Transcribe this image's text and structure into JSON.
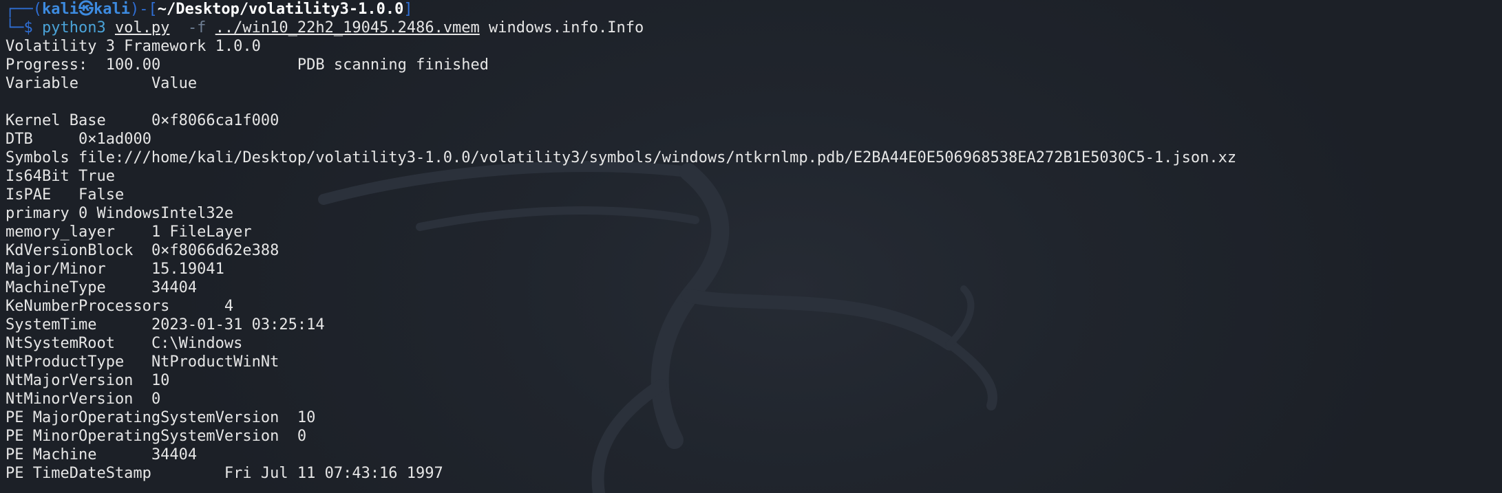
{
  "prompt": {
    "box_top_prefix": "┌──(",
    "user": "kali",
    "at_symbol": "㉿",
    "host": "kali",
    "bracket_mid": ")-[",
    "cwd": "~/Desktop/volatility3-1.0.0",
    "bracket_end": "]",
    "box_bottom_prefix": "└─$ ",
    "command": "python3",
    "script": "vol.py",
    "flag": "-f",
    "image_path": "../win10_22h2_19045.2486.vmem",
    "plugin": "windows.info.Info"
  },
  "output": {
    "framework": "Volatility 3 Framework 1.0.0",
    "progress_label": "Progress:",
    "progress_value": "100.00",
    "progress_status": "PDB scanning finished",
    "header_variable": "Variable",
    "header_value": "Value",
    "rows": [
      {
        "key": "Kernel Base",
        "value": "0×f8066ca1f000"
      },
      {
        "key": "DTB",
        "value": "0×1ad000"
      },
      {
        "key": "Symbols",
        "value": "file:///home/kali/Desktop/volatility3-1.0.0/volatility3/symbols/windows/ntkrnlmp.pdb/E2BA44E0E506968538EA272B1E5030C5-1.json.xz"
      },
      {
        "key": "Is64Bit",
        "value": "True"
      },
      {
        "key": "IsPAE",
        "value": "False"
      },
      {
        "key": "primary",
        "value": "0 WindowsIntel32e"
      },
      {
        "key": "memory_layer",
        "value": "1 FileLayer"
      },
      {
        "key": "KdVersionBlock",
        "value": "0×f8066d62e388"
      },
      {
        "key": "Major/Minor",
        "value": "15.19041"
      },
      {
        "key": "MachineType",
        "value": "34404"
      },
      {
        "key": "KeNumberProcessors",
        "value": "4"
      },
      {
        "key": "SystemTime",
        "value": "2023-01-31 03:25:14"
      },
      {
        "key": "NtSystemRoot",
        "value": "C:\\Windows"
      },
      {
        "key": "NtProductType",
        "value": "NtProductWinNt"
      },
      {
        "key": "NtMajorVersion",
        "value": "10"
      },
      {
        "key": "NtMinorVersion",
        "value": "0"
      },
      {
        "key": "PE MajorOperatingSystemVersion",
        "value": "10"
      },
      {
        "key": "PE MinorOperatingSystemVersion",
        "value": "0"
      },
      {
        "key": "PE Machine",
        "value": "34404"
      },
      {
        "key": "PE TimeDateStamp",
        "value": "Fri Jul 11 07:43:16 1997"
      }
    ]
  },
  "colors": {
    "background": "#1f232b",
    "text": "#e6e6e6",
    "prompt_blue": "#2f6fd6",
    "command_cyan": "#4aa3d8"
  },
  "icons": {
    "watermark": "kali-dragon-icon"
  }
}
